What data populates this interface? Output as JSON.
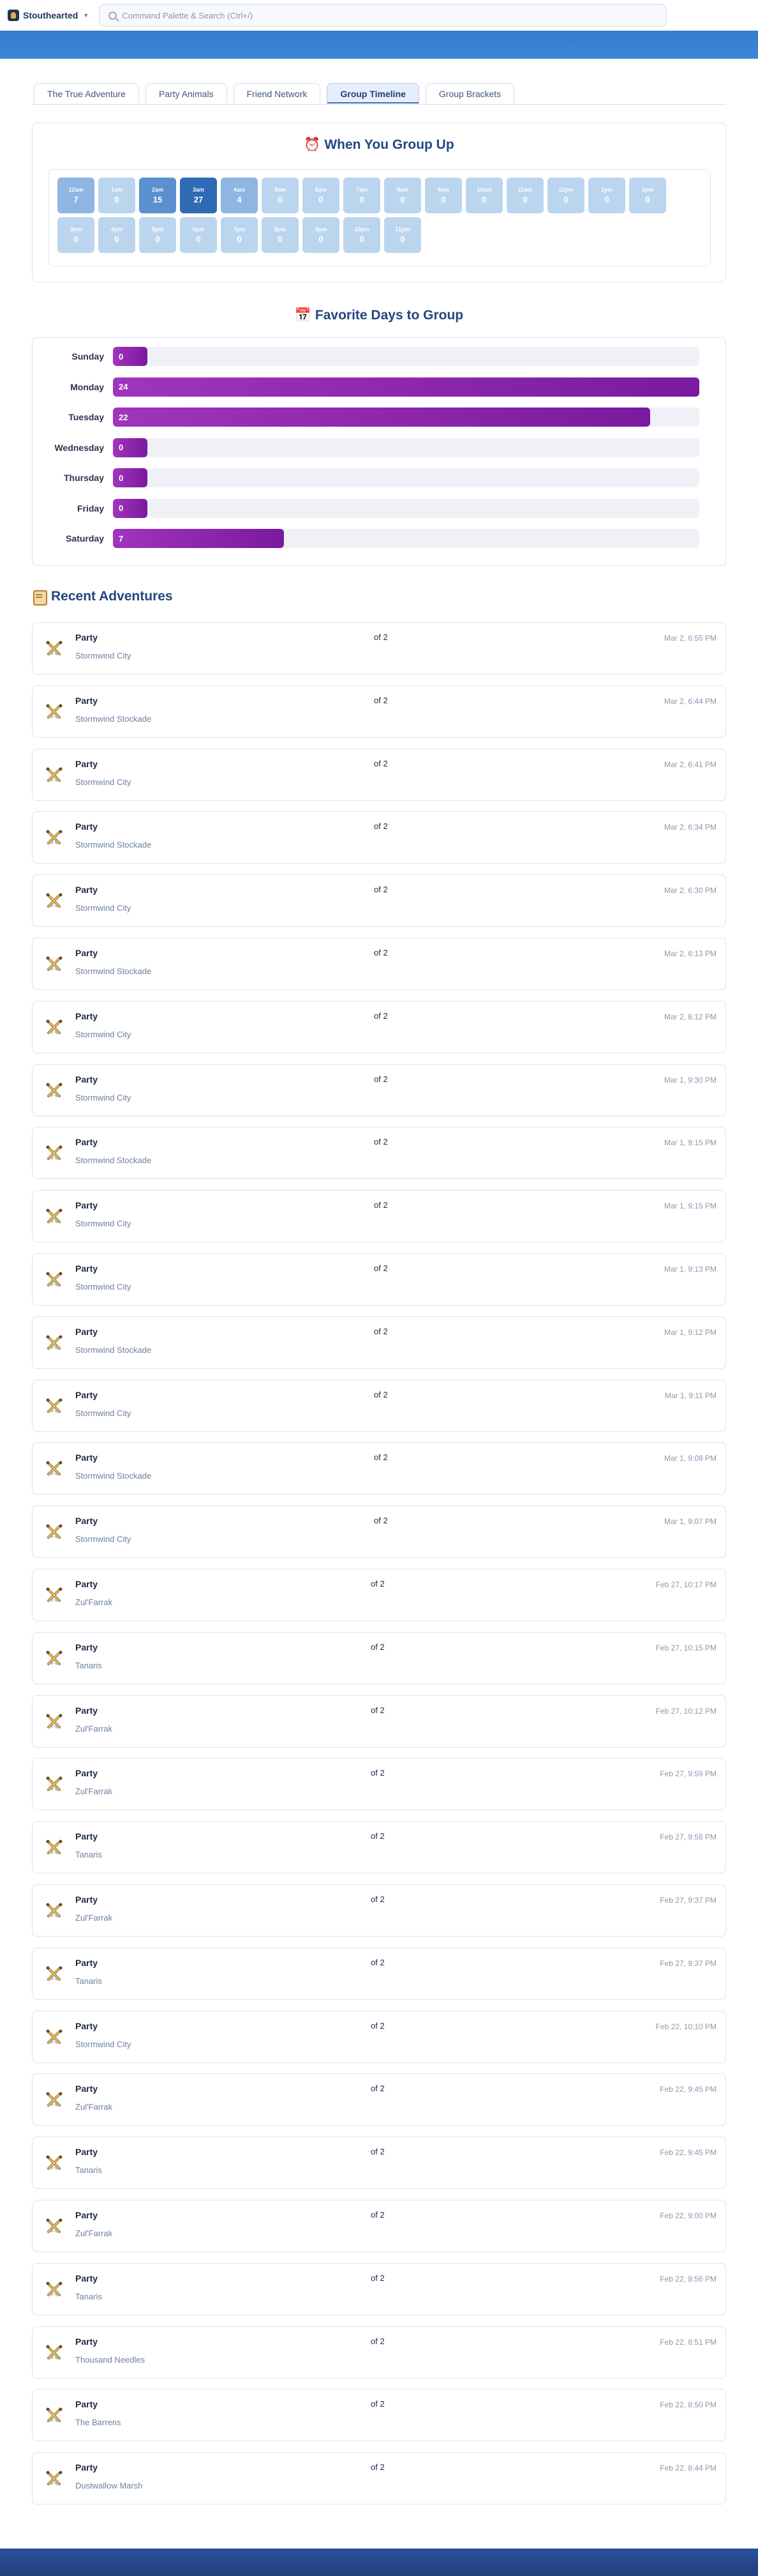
{
  "topbar": {
    "brand_label": "Stouthearted",
    "command_placeholder": "Command Palette & Search (Ctrl+/)"
  },
  "tabs": [
    {
      "label": "The True Adventure"
    },
    {
      "label": "Party Animals"
    },
    {
      "label": "Friend Network"
    },
    {
      "label": "Group Timeline"
    },
    {
      "label": "Group Brackets"
    }
  ],
  "when": {
    "title": "When You Group Up",
    "hours": [
      {
        "label": "12am",
        "value": "7"
      },
      {
        "label": "1am",
        "value": "0"
      },
      {
        "label": "2am",
        "value": "15"
      },
      {
        "label": "3am",
        "value": "27"
      },
      {
        "label": "4am",
        "value": "4"
      },
      {
        "label": "5am",
        "value": "0"
      },
      {
        "label": "6am",
        "value": "0"
      },
      {
        "label": "7am",
        "value": "0"
      },
      {
        "label": "8am",
        "value": "0"
      },
      {
        "label": "9am",
        "value": "0"
      },
      {
        "label": "10am",
        "value": "0"
      },
      {
        "label": "11am",
        "value": "0"
      },
      {
        "label": "12pm",
        "value": "0"
      },
      {
        "label": "1pm",
        "value": "0"
      },
      {
        "label": "2pm",
        "value": "0"
      },
      {
        "label": "3pm",
        "value": "0"
      },
      {
        "label": "4pm",
        "value": "0"
      },
      {
        "label": "5pm",
        "value": "0"
      },
      {
        "label": "6pm",
        "value": "0"
      },
      {
        "label": "7pm",
        "value": "0"
      },
      {
        "label": "8pm",
        "value": "0"
      },
      {
        "label": "9pm",
        "value": "0"
      },
      {
        "label": "10pm",
        "value": "0"
      },
      {
        "label": "11pm",
        "value": "0"
      }
    ]
  },
  "days": {
    "title": "Favorite Days to Group",
    "max": 24,
    "rows": [
      {
        "day": "Sunday",
        "count": "0"
      },
      {
        "day": "Monday",
        "count": "24"
      },
      {
        "day": "Tuesday",
        "count": "22"
      },
      {
        "day": "Wednesday",
        "count": "0"
      },
      {
        "day": "Thursday",
        "count": "0"
      },
      {
        "day": "Friday",
        "count": "0"
      },
      {
        "day": "Saturday",
        "count": "7"
      }
    ]
  },
  "adventures": {
    "title": "Recent Adventures",
    "items": [
      {
        "name": "Party",
        "count": "of 2",
        "zone": "Stormwind City",
        "time": "Mar 2, 6:55 PM"
      },
      {
        "name": "Party",
        "count": "of 2",
        "zone": "Stormwind Stockade",
        "time": "Mar 2, 6:44 PM"
      },
      {
        "name": "Party",
        "count": "of 2",
        "zone": "Stormwind City",
        "time": "Mar 2, 6:41 PM"
      },
      {
        "name": "Party",
        "count": "of 2",
        "zone": "Stormwind Stockade",
        "time": "Mar 2, 6:34 PM"
      },
      {
        "name": "Party",
        "count": "of 2",
        "zone": "Stormwind City",
        "time": "Mar 2, 6:30 PM"
      },
      {
        "name": "Party",
        "count": "of 2",
        "zone": "Stormwind Stockade",
        "time": "Mar 2, 6:13 PM"
      },
      {
        "name": "Party",
        "count": "of 2",
        "zone": "Stormwind City",
        "time": "Mar 2, 6:12 PM"
      },
      {
        "name": "Party",
        "count": "of 2",
        "zone": "Stormwind City",
        "time": "Mar 1, 9:30 PM"
      },
      {
        "name": "Party",
        "count": "of 2",
        "zone": "Stormwind Stockade",
        "time": "Mar 1, 9:15 PM"
      },
      {
        "name": "Party",
        "count": "of 2",
        "zone": "Stormwind City",
        "time": "Mar 1, 9:15 PM"
      },
      {
        "name": "Party",
        "count": "of 2",
        "zone": "Stormwind City",
        "time": "Mar 1, 9:13 PM"
      },
      {
        "name": "Party",
        "count": "of 2",
        "zone": "Stormwind Stockade",
        "time": "Mar 1, 9:12 PM"
      },
      {
        "name": "Party",
        "count": "of 2",
        "zone": "Stormwind City",
        "time": "Mar 1, 9:11 PM"
      },
      {
        "name": "Party",
        "count": "of 2",
        "zone": "Stormwind Stockade",
        "time": "Mar 1, 9:08 PM"
      },
      {
        "name": "Party",
        "count": "of 2",
        "zone": "Stormwind City",
        "time": "Mar 1, 9:07 PM"
      },
      {
        "name": "Party",
        "count": "of 2",
        "zone": "Zul'Farrak",
        "time": "Feb 27, 10:17 PM"
      },
      {
        "name": "Party",
        "count": "of 2",
        "zone": "Tanaris",
        "time": "Feb 27, 10:15 PM"
      },
      {
        "name": "Party",
        "count": "of 2",
        "zone": "Zul'Farrak",
        "time": "Feb 27, 10:12 PM"
      },
      {
        "name": "Party",
        "count": "of 2",
        "zone": "Zul'Farrak",
        "time": "Feb 27, 9:59 PM"
      },
      {
        "name": "Party",
        "count": "of 2",
        "zone": "Tanaris",
        "time": "Feb 27, 9:58 PM"
      },
      {
        "name": "Party",
        "count": "of 2",
        "zone": "Zul'Farrak",
        "time": "Feb 27, 9:37 PM"
      },
      {
        "name": "Party",
        "count": "of 2",
        "zone": "Tanaris",
        "time": "Feb 27, 9:37 PM"
      },
      {
        "name": "Party",
        "count": "of 2",
        "zone": "Stormwind City",
        "time": "Feb 22, 10:10 PM"
      },
      {
        "name": "Party",
        "count": "of 2",
        "zone": "Zul'Farrak",
        "time": "Feb 22, 9:45 PM"
      },
      {
        "name": "Party",
        "count": "of 2",
        "zone": "Tanaris",
        "time": "Feb 22, 9:45 PM"
      },
      {
        "name": "Party",
        "count": "of 2",
        "zone": "Zul'Farrak",
        "time": "Feb 22, 9:00 PM"
      },
      {
        "name": "Party",
        "count": "of 2",
        "zone": "Tanaris",
        "time": "Feb 22, 8:56 PM"
      },
      {
        "name": "Party",
        "count": "of 2",
        "zone": "Thousand Needles",
        "time": "Feb 22, 8:51 PM"
      },
      {
        "name": "Party",
        "count": "of 2",
        "zone": "The Barrens",
        "time": "Feb 22, 8:50 PM"
      },
      {
        "name": "Party",
        "count": "of 2",
        "zone": "Dustwallow Marsh",
        "time": "Feb 22, 8:44 PM"
      }
    ]
  }
}
